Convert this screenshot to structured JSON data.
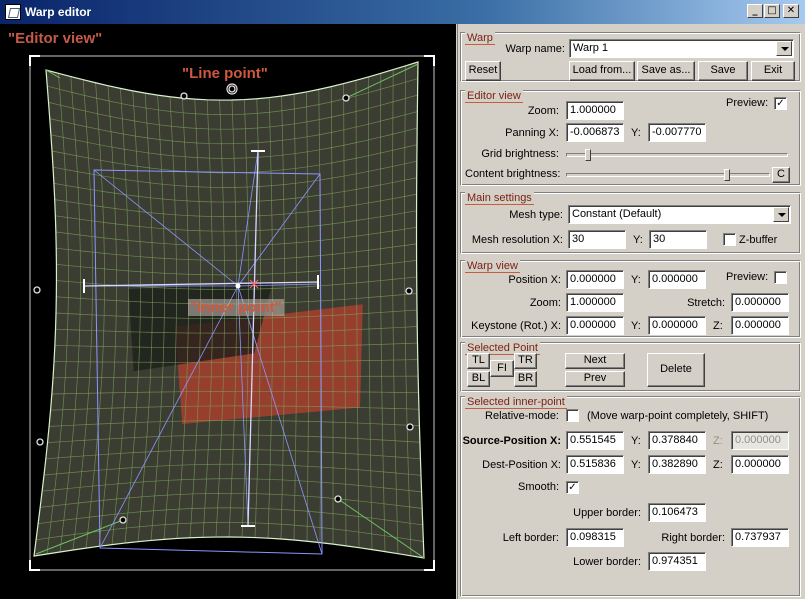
{
  "window": {
    "title": "Warp editor",
    "minimize": "_",
    "maximize": "□",
    "close": "✕"
  },
  "viewer": {
    "label": "\"Editor view\"",
    "line_point_label": "\"Line point\"",
    "inner_point_label": "\"Inner point\"",
    "mesh_color": "#7ea05a",
    "border_color": "#d8f0c8",
    "guide_color": "#8c96ff"
  },
  "warp": {
    "title": "Warp",
    "name_label": "Warp name:",
    "name_value": "Warp 1",
    "reset": "Reset",
    "load": "Load from...",
    "save_as": "Save as...",
    "save": "Save",
    "exit": "Exit"
  },
  "editor_view": {
    "title": "Editor view",
    "zoom_label": "Zoom:",
    "zoom": "1.000000",
    "preview_label": "Preview:",
    "preview_checked": "✓",
    "panning_x_label": "Panning X:",
    "panning_x": "-0.006873",
    "y_label": "Y:",
    "panning_y": "-0.007770",
    "grid_brightness_label": "Grid brightness:",
    "grid_brightness": 0.1,
    "content_brightness_label": "Content brightness:",
    "content_brightness": 0.79,
    "c_button": "C"
  },
  "main_settings": {
    "title": "Main settings",
    "mesh_type_label": "Mesh type:",
    "mesh_type": "Constant (Default)",
    "mesh_res_label": "Mesh resolution X:",
    "mesh_res_x": "30",
    "y_label": "Y:",
    "mesh_res_y": "30",
    "zbuffer_label": "Z-buffer"
  },
  "warp_view": {
    "title": "Warp view",
    "position_x_label": "Position X:",
    "position_x": "0.000000",
    "y_label": "Y:",
    "position_y": "0.000000",
    "preview_label": "Preview:",
    "zoom_label": "Zoom:",
    "zoom": "1.000000",
    "stretch_label": "Stretch:",
    "stretch": "0.000000",
    "keystone_label": "Keystone (Rot.) X:",
    "keystone_x": "0.000000",
    "keystone_y_label": "Y:",
    "keystone_y": "0.000000",
    "z_label": "Z:",
    "keystone_z": "0.000000"
  },
  "selected_point": {
    "title": "Selected Point",
    "tl": "TL",
    "tr": "TR",
    "fi": "FI",
    "bl": "BL",
    "br": "BR",
    "next": "Next",
    "prev": "Prev",
    "delete": "Delete"
  },
  "selected_inner": {
    "title": "Selected inner-point",
    "relative_label": "Relative-mode:",
    "relative_hint": "(Move warp-point completely, SHIFT)",
    "source_label": "Source-Position X:",
    "source_x": "0.551545",
    "y_label": "Y:",
    "source_y": "0.378840",
    "z_label": "Z:",
    "source_z": "0.000000",
    "dest_label": "Dest-Position X:",
    "dest_x": "0.515836",
    "dest_y": "0.382890",
    "dest_z": "0.000000",
    "smooth_label": "Smooth:",
    "smooth_checked": "✓",
    "upper_label": "Upper border:",
    "upper": "0.106473",
    "left_label": "Left border:",
    "left": "0.098315",
    "right_label": "Right border:",
    "right": "0.737937",
    "lower_label": "Lower border:",
    "lower": "0.974351"
  }
}
